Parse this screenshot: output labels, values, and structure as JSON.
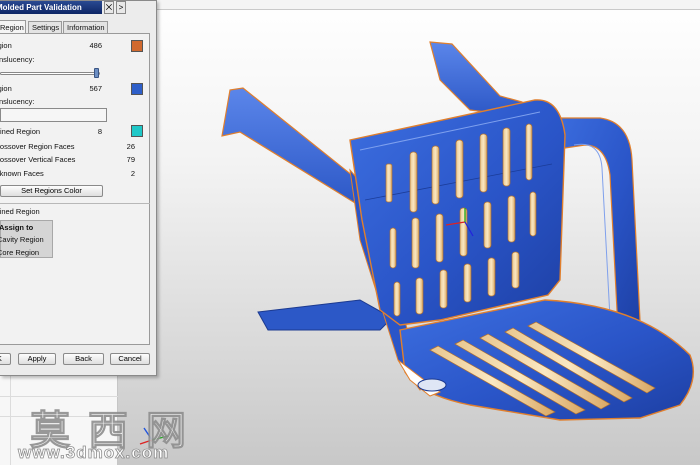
{
  "dialog": {
    "title": "Molded Part Validation",
    "title_buttons": [
      "⨉",
      ">"
    ],
    "tabs": [
      "Region",
      "Settings",
      "Information"
    ],
    "regions": {
      "region1": {
        "label": "Region",
        "count": "486",
        "color": "#d0692f"
      },
      "translucency1": "Translucency:",
      "region2": {
        "label": "Region",
        "count": "567",
        "color": "#2e5fc9"
      },
      "translucency2": "Translucency:",
      "undefined": {
        "label": "Undefined Region",
        "count": "8",
        "color": "#1fc8c8"
      }
    },
    "faces": [
      {
        "label": "Crossover Region Faces",
        "count": "26"
      },
      {
        "label": "Crossover Vertical Faces",
        "count": "79"
      },
      {
        "label": "Unknown Faces",
        "count": "2"
      }
    ],
    "set_colors_button": "Set Regions Color",
    "defined_region_label": "Defined Region",
    "assign_group": {
      "title": "Assign to",
      "options": [
        "Cavity Region",
        "Core Region"
      ]
    },
    "footer_buttons": {
      "ok": "OK",
      "apply": "Apply",
      "back": "Back",
      "cancel": "Cancel"
    }
  },
  "watermark": {
    "chinese": "莫西网",
    "url": "www.3dmox.com"
  }
}
